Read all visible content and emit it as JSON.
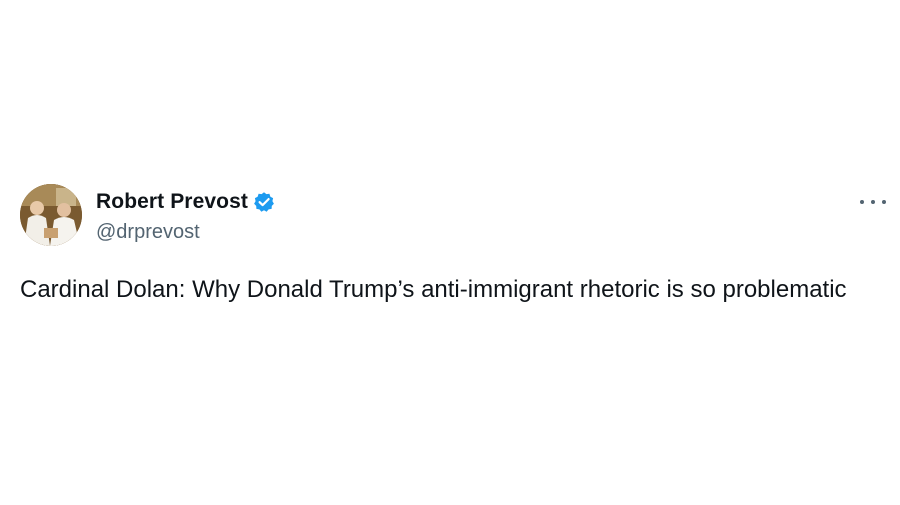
{
  "tweet": {
    "author": {
      "display_name": "Robert Prevost",
      "handle": "@drprevost",
      "verified": true,
      "avatar_icon": "avatar-photo"
    },
    "text": "Cardinal Dolan: Why Donald Trump’s anti-immigrant rhetoric is so problematic",
    "more_icon": "more-options-icon"
  },
  "colors": {
    "text_primary": "#0f1419",
    "text_secondary": "#536471",
    "verified_blue": "#1d9bf0",
    "background": "#ffffff"
  }
}
